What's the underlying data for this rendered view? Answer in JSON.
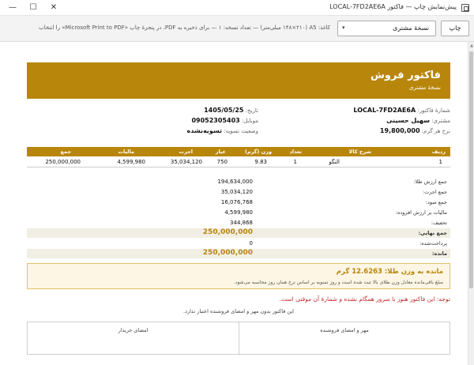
{
  "window": {
    "title": "پیش‌نمایش چاپ — فاکتور LOCAL-7FD2AE6A",
    "controls": {
      "minimize": "—",
      "maximize": "☐",
      "close": "✕"
    }
  },
  "toolbar": {
    "print_label": "چاپ",
    "copy_select": {
      "value": "نسخهٔ مشتری",
      "chevron": "▾"
    },
    "info": "کاغذ: A5 (۱۴۸×۲۱۰ میلی‌متر) — تعداد نسخه: ۱ — برای ذخیره به PDF، در پنجرهٔ چاپ «Microsoft Print to PDF» را انتخاب"
  },
  "scroll_up_glyph": "▲",
  "invoice": {
    "title": "فاکتور فروش",
    "subtitle": "نسخهٔ مشتری",
    "meta_right": [
      {
        "label": "شمارهٔ فاکتور:",
        "value": "LOCAL-7FD2AE6A"
      },
      {
        "label": "مشتری:",
        "value": "سهیل حسینی"
      },
      {
        "label": "نرخ هر گرم:",
        "value": "19,800,000"
      }
    ],
    "meta_left": [
      {
        "label": "تاریخ:",
        "value": "1405/05/25"
      },
      {
        "label": "موبایل:",
        "value": "09052305403"
      },
      {
        "label": "وضعیت تسویه:",
        "value": "تسویه‌نشده"
      }
    ],
    "items_table": {
      "headers": {
        "row": "ردیف",
        "desc": "شرح کالا",
        "qty": "تعداد",
        "weight": "وزن (گرم)",
        "karat": "عیار",
        "wage": "اجرت",
        "tax": "مالیات",
        "total": "جمع"
      },
      "rows": [
        {
          "row": "1",
          "desc": "النگو",
          "qty": "1",
          "weight": "9.83",
          "karat": "750",
          "wage": "35,034,120",
          "tax": "4,599,980",
          "total": "250,000,000"
        }
      ]
    },
    "totals": [
      {
        "label": "جمع ارزش طلا:",
        "value": "194,634,000"
      },
      {
        "label": "جمع اجرت:",
        "value": "35,034,120"
      },
      {
        "label": "جمع سود:",
        "value": "16,076,768"
      },
      {
        "label": "مالیات بر ارزش افزوده:",
        "value": "4,599,980"
      },
      {
        "label": "تخفیف:",
        "value": "344,868"
      },
      {
        "label": "جمع نهایی:",
        "value": "250,000,000"
      },
      {
        "label": "پرداخت‌شده:",
        "value": "0"
      },
      {
        "label": "مانده:",
        "value": "250,000,000"
      }
    ],
    "gold_notice": {
      "headline": "مانده به وزن طلا: 12.6263 گرم",
      "detail": "مبلغ باقی‌مانده معادل وزن طلای بالا ثبت شده است و روز تسویه بر اساس نرخ همان روز محاسبه می‌شود."
    },
    "warning": "توجه: این فاکتور هنوز با سرور همگام نشده و شمارهٔ آن موقتی است.",
    "note": "این فاکتور بدون مهر و امضای فروشنده اعتبار ندارد.",
    "signatures": {
      "seller": "مهر و امضای فروشنده",
      "buyer": "امضای خریدار"
    }
  },
  "colors": {
    "accent_gold": "#b8860b",
    "warning_red": "#c0282c",
    "notice_bg": "#fdf6e4"
  }
}
